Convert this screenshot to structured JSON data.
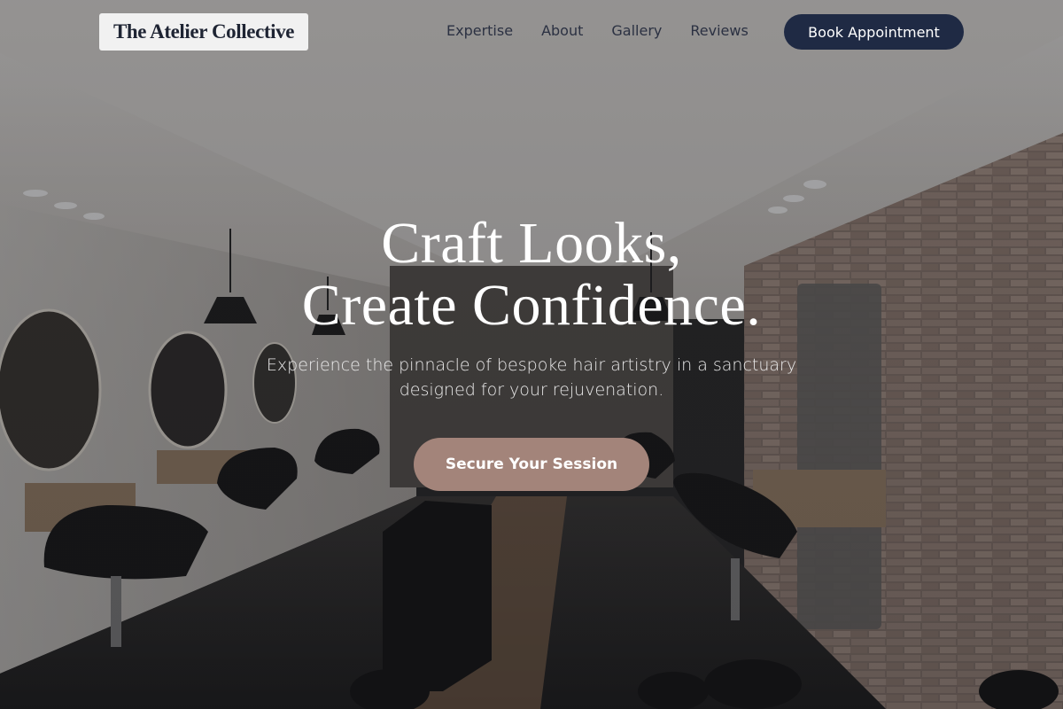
{
  "header": {
    "brand": "The Atelier Collective",
    "nav": [
      {
        "label": "Expertise"
      },
      {
        "label": "About"
      },
      {
        "label": "Gallery"
      },
      {
        "label": "Reviews"
      }
    ],
    "cta_label": "Book Appointment"
  },
  "hero": {
    "title_line1": "Craft Looks,",
    "title_line2": "Create Confidence.",
    "subtitle": "Experience the pinnacle of bespoke hair artistry in a sanctuary designed for your rejuvenation.",
    "cta_label": "Secure Your Session"
  },
  "colors": {
    "nav_text": "#2b3142",
    "cta_primary_bg": "#1f2a44",
    "hero_cta_bg": "#a3847a",
    "logo_bg": "#f1f1f1"
  }
}
